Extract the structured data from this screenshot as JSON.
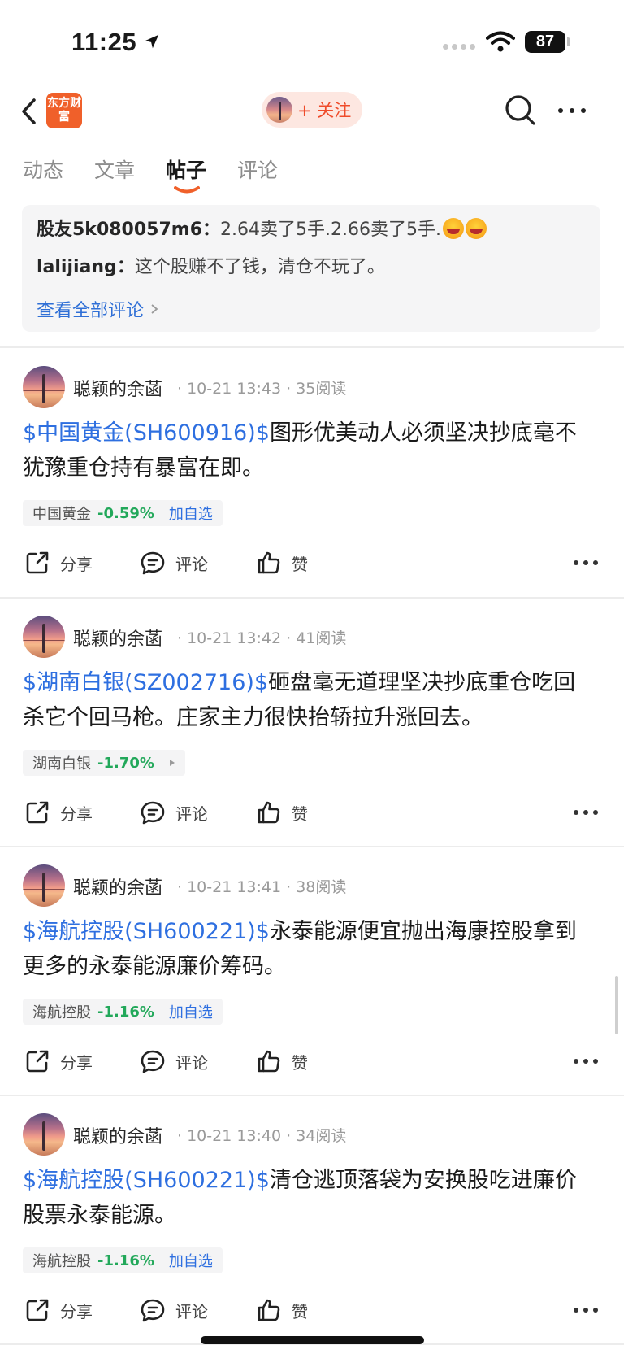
{
  "status_bar": {
    "time": "11:25",
    "battery": "87"
  },
  "nav": {
    "logo_text": "东方财富",
    "follow_label": "+ 关注"
  },
  "tabs": [
    {
      "label": "动态"
    },
    {
      "label": "文章"
    },
    {
      "label": "帖子",
      "active": true
    },
    {
      "label": "评论"
    }
  ],
  "comments": {
    "items": [
      {
        "user": "股友5k080057m6",
        "separator": "：",
        "text": "2.64卖了5手.2.66卖了5手."
      },
      {
        "user": "lalijiang",
        "separator": "：",
        "text": "这个股赚不了钱，清仓不玩了。"
      }
    ],
    "view_all": "查看全部评论"
  },
  "posts": [
    {
      "author": "聪颖的余菡",
      "meta": "· 10-21 13:43 · 35阅读",
      "ticker": "$中国黄金(SH600916)$",
      "text": "图形优美动人必须坚决抄底毫不犹豫重仓持有暴富在即。",
      "tag_name": "中国黄金",
      "tag_change": "-0.59%",
      "tag_action": "加自选",
      "actions": {
        "share": "分享",
        "comment": "评论",
        "like": "赞"
      }
    },
    {
      "author": "聪颖的余菡",
      "meta": "· 10-21 13:42 · 41阅读",
      "ticker": "$湖南白银(SZ002716)$",
      "text": "砸盘毫无道理坚决抄底重仓吃回杀它个回马枪。庄家主力很快抬轿拉升涨回去。",
      "tag_name": "湖南白银",
      "tag_change": "-1.70%",
      "tag_action": "",
      "actions": {
        "share": "分享",
        "comment": "评论",
        "like": "赞"
      }
    },
    {
      "author": "聪颖的余菡",
      "meta": "· 10-21 13:41 · 38阅读",
      "ticker": "$海航控股(SH600221)$",
      "text": "永泰能源便宜抛出海康控股拿到更多的永泰能源廉价筹码。",
      "tag_name": "海航控股",
      "tag_change": "-1.16%",
      "tag_action": "加自选",
      "actions": {
        "share": "分享",
        "comment": "评论",
        "like": "赞"
      }
    },
    {
      "author": "聪颖的余菡",
      "meta": "· 10-21 13:40 · 34阅读",
      "ticker": "$海航控股(SH600221)$",
      "text": "清仓逃顶落袋为安换股吃进廉价股票永泰能源。",
      "tag_name": "海航控股",
      "tag_change": "-1.16%",
      "tag_action": "加自选",
      "actions": {
        "share": "分享",
        "comment": "评论",
        "like": "赞"
      }
    }
  ],
  "colors": {
    "brand": "#f0602a",
    "link": "#2e6fe0",
    "down": "#22a85a",
    "follow_text": "#ef4b2a"
  }
}
